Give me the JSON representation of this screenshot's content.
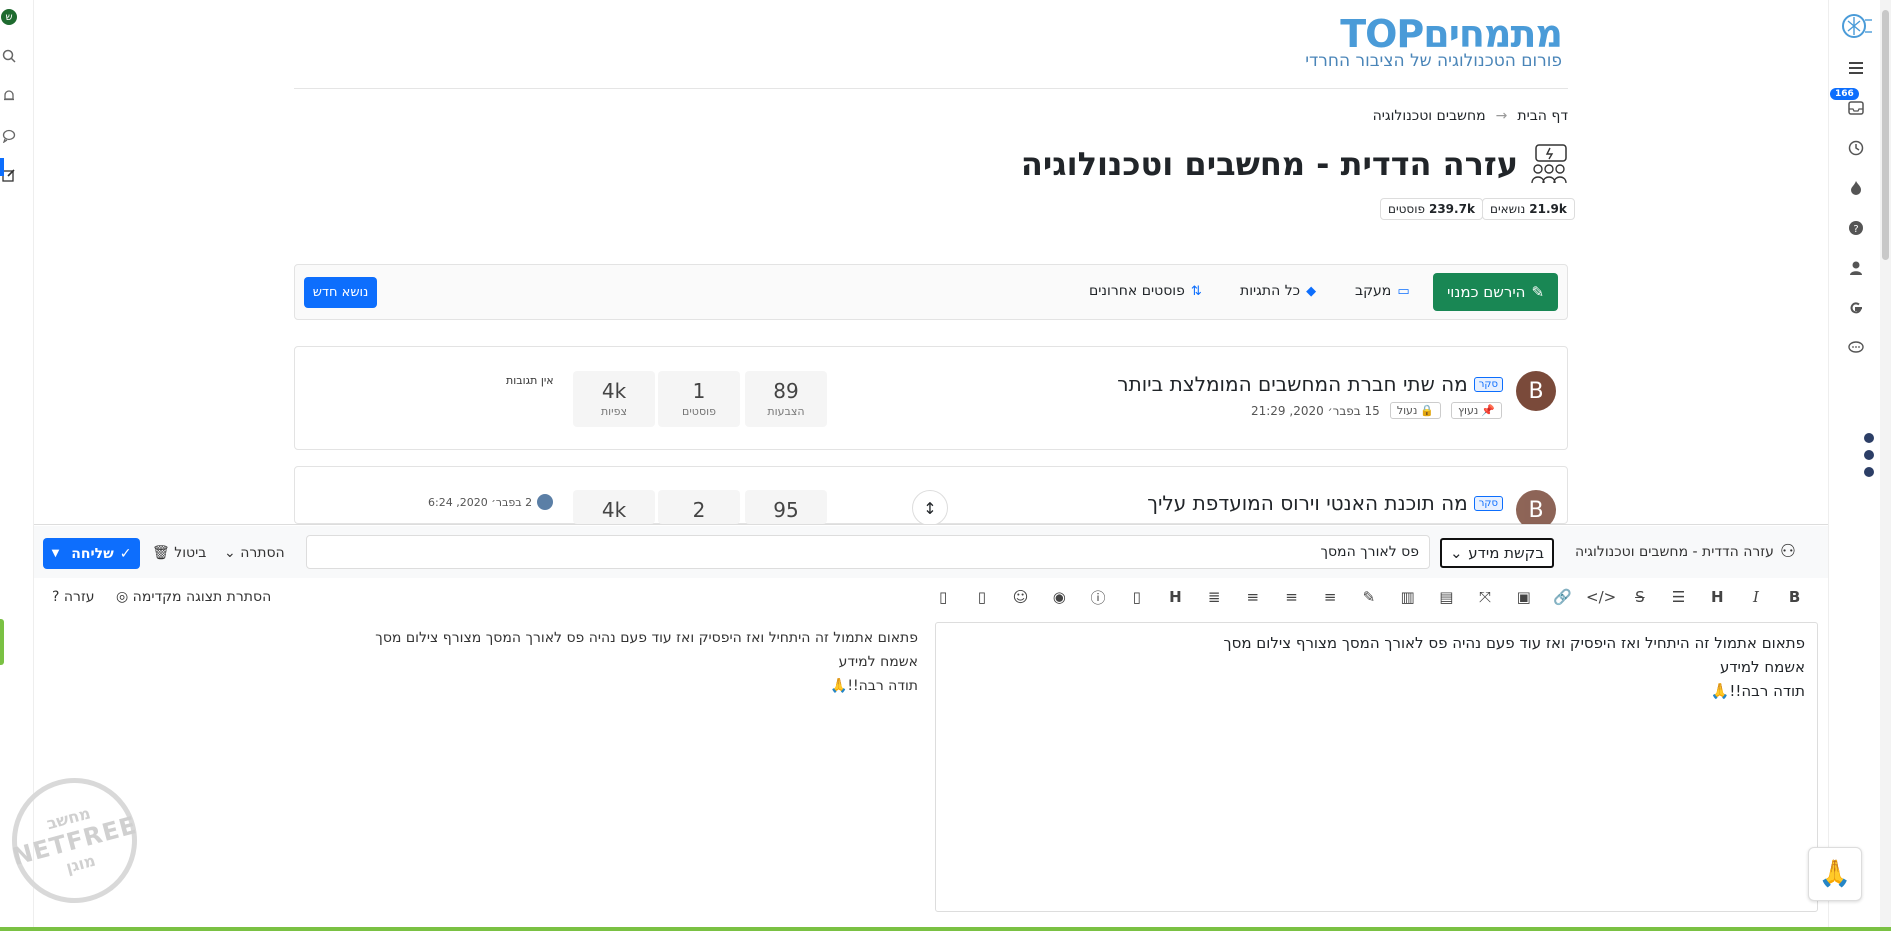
{
  "left_rail": {
    "avatar_letter": "ש"
  },
  "right_rail": {
    "unread_badge": "166"
  },
  "header": {
    "logo_title": "מתמחיםTOP",
    "logo_subtitle": "פורום הטכנולוגיה של הציבור החרדי"
  },
  "breadcrumb": {
    "home": "דף הבית",
    "separator": "→",
    "current": "מחשבים וטכנולוגיה"
  },
  "category": {
    "title": "עזרה הדדית - מחשבים וטכנולוגיה",
    "topics_count": "21.9k",
    "topics_label": "נושאים",
    "posts_count": "239.7k",
    "posts_label": "פוסטים"
  },
  "toolbar": {
    "watch_label": "הירשם כמנוי",
    "tracking_label": "מעקב",
    "all_tags_label": "כל התגיות",
    "recent_posts_label": "פוסטים אחרונים",
    "new_topic_label": "נושא חדש"
  },
  "topics": [
    {
      "avatar": "B",
      "poll_label": "סקר",
      "title": "מה שתי חברת המחשבים המומלצת ביותר",
      "pinned_label": "נעוץ",
      "locked_label": "נעול",
      "timestamp": "15 בפבר׳ 2020, 21:29",
      "votes": "89",
      "votes_label": "הצבעות",
      "posts": "1",
      "posts_label": "פוסטים",
      "views": "4k",
      "views_label": "צפיות",
      "last_reply": "אין תגובות"
    },
    {
      "avatar": "B",
      "poll_label": "סקר",
      "title": "מה תוכנת האנטי וירוס המועדפת עליך",
      "votes": "95",
      "posts": "2",
      "views": "4k",
      "last_reply_time": "2 בפבר׳ 2020, 6:24"
    }
  ],
  "composer": {
    "category": "עזרה הדדית - מחשבים וטכנולוגיה",
    "type_select": "בקשת מידע",
    "title_value": "פס לאורך המסך",
    "hide_label": "הסתרה",
    "cancel_label": "ביטול",
    "send_label": "שליחה",
    "hide_preview_label": "הסתרת תצוגה מקדימה",
    "help_label": "עזרה",
    "body_line1": "פתאום אתמול זה היתחיל ואז היפסיק ואז עוד פעם נהיה פס לאורך המסך מצורף צילום מסך",
    "body_line2": "אשמח למידע",
    "body_line3": "תודה רבה!!🙏",
    "emoji_button": "🙏"
  },
  "watermark": {
    "line1": "מחשב",
    "line2": "NETFREE",
    "line3": "מוגן"
  },
  "colors": {
    "accent": "#0d6efd",
    "success": "#198754",
    "netfree_green": "#7ac143"
  }
}
